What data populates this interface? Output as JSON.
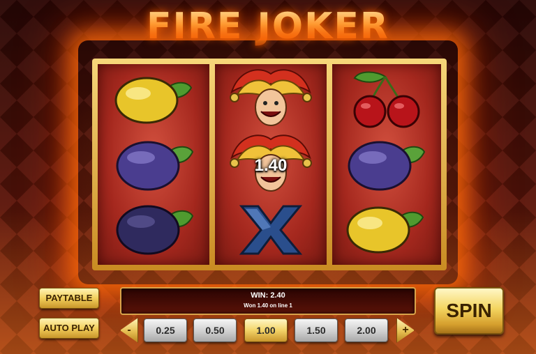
{
  "game": {
    "title": "FIRE JOKER"
  },
  "reels": [
    {
      "symbols": [
        "lemon",
        "plum",
        "plum"
      ]
    },
    {
      "symbols": [
        "joker",
        "joker",
        "blue-x"
      ]
    },
    {
      "symbols": [
        "cherry",
        "plum",
        "lemon"
      ]
    }
  ],
  "highlight": {
    "win_amount": "1.40"
  },
  "controls": {
    "paytable_label": "PAYTABLE",
    "autoplay_label": "AUTO PLAY",
    "spin_label": "SPIN",
    "decrease_label": "-",
    "increase_label": "+"
  },
  "win_panel": {
    "main": "WIN:  2.40",
    "sub": "Won 1.40 on line 1"
  },
  "bets": {
    "options": [
      "0.25",
      "0.50",
      "1.00",
      "1.50",
      "2.00"
    ],
    "selected": "1.00"
  },
  "colors": {
    "accent_gold": "#f2cf5c",
    "reel_red": "#a5281e",
    "fire_orange": "#ff6e0a"
  }
}
